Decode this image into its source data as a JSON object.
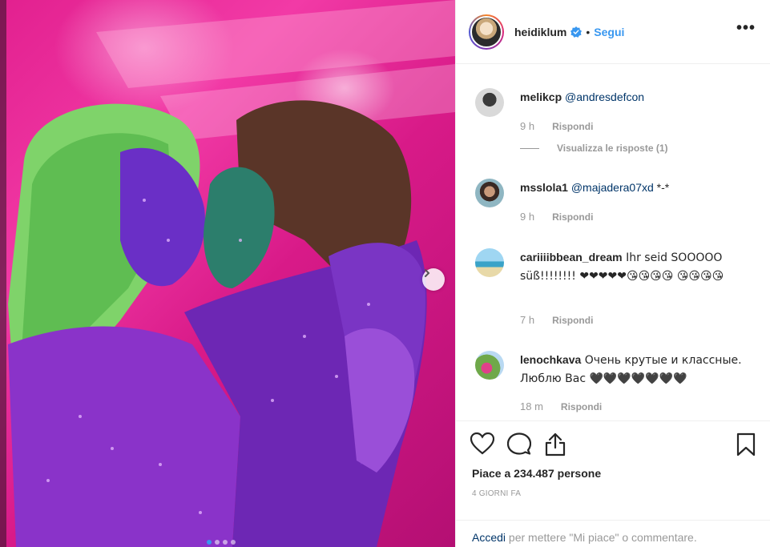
{
  "post": {
    "username": "heidiklum",
    "separator": "•",
    "follow_label": "Segui",
    "more_label": "•••"
  },
  "comments": [
    {
      "user": "melikcp",
      "text": "@andresdefcon",
      "time": "9 h",
      "reply_label": "Rispondi",
      "view_replies": "Visualizza le risposte (1)"
    },
    {
      "user": "msslola1",
      "mention": "@majadera07xd",
      "text": " *-*",
      "time": "9 h",
      "reply_label": "Rispondi"
    },
    {
      "user": "cariiiibbean_dream",
      "text": " Ihr seid SOOOOO süß!!!!!!!! ❤❤❤❤❤😘😘😘😘 😘😘😘😘",
      "time": "7 h",
      "reply_label": "Rispondi"
    },
    {
      "user": "lenochkava",
      "text": " Очень крутые и классные. Люблю Вас 🖤🖤🖤🖤🖤🖤🖤",
      "time": "18 m",
      "reply_label": "Rispondi"
    }
  ],
  "actions": {
    "likes_text": "Piace a 234.487 persone",
    "time_ago": "4 GIORNI FA",
    "login_link": "Accedi",
    "login_text": " per mettere \"Mi piace\" o commentare."
  },
  "carousel": {
    "slide_count": 4,
    "active_index": 0
  },
  "colors": {
    "accent": "#3897f0",
    "link": "#003569",
    "muted": "#999999",
    "photo_pink": "#e2208f"
  }
}
